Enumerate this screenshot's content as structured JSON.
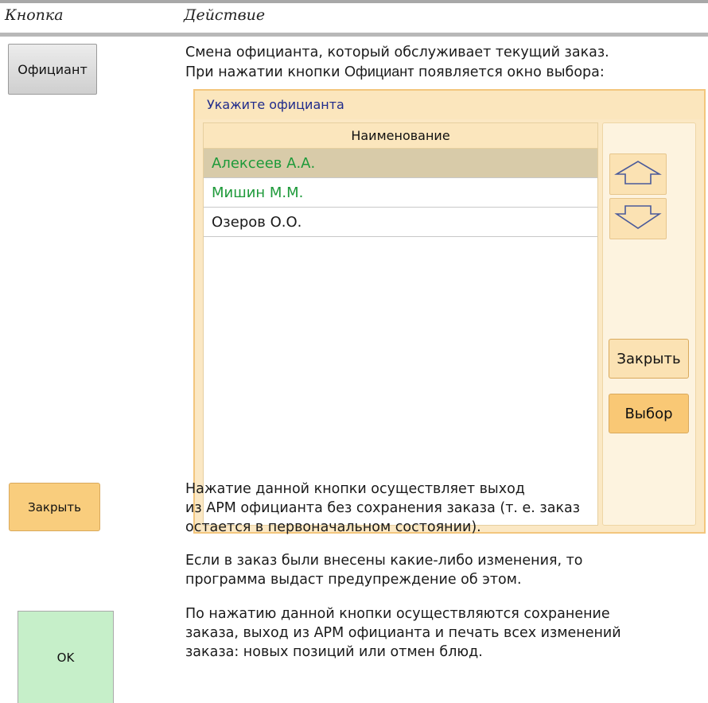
{
  "header": {
    "col_button": "Кнопка",
    "col_action": "Действие"
  },
  "waiter": {
    "button_label": "Официант",
    "desc_line1": "Смена официанта, который обслуживает текущий заказ.",
    "desc_line2_prefix": "При нажатии кнопки ",
    "desc_line2_button": "Официант",
    "desc_line2_suffix": " появляется окно выбора:"
  },
  "dialog": {
    "title": "Укажите официанта",
    "column_header": "Наименование",
    "rows": [
      {
        "name": "Алексеев А.А."
      },
      {
        "name": "Мишин М.М."
      },
      {
        "name": "Озеров О.О."
      }
    ],
    "up_icon": "arrow-up-icon",
    "down_icon": "arrow-down-icon",
    "close_label": "Закрыть",
    "select_label": "Выбор",
    "colors": {
      "border": "#f3c67d",
      "selected_row": "#d8cba9",
      "green_text": "#1e9a3a",
      "title_text": "#1f2b8c"
    }
  },
  "close": {
    "button_label": "Закрыть",
    "desc_p1_line1": "Нажатие данной кнопки осуществляет выход",
    "desc_p1_line2": "из АРМ официанта без сохранения заказа (т. е. заказ",
    "desc_p1_line3": "остается в первоначальном состоянии).",
    "desc_p2_line1": "Если в заказ были внесены какие-либо изменения, то",
    "desc_p2_line2": "программа выдаст предупреждение об этом."
  },
  "ok": {
    "button_label": "OK",
    "desc_line1": "По нажатию данной кнопки осуществляются сохранение",
    "desc_line2": "заказа, выход из АРМ официанта и печать всех изменений",
    "desc_line3": "заказа: новых позиций или отмен блюд."
  }
}
